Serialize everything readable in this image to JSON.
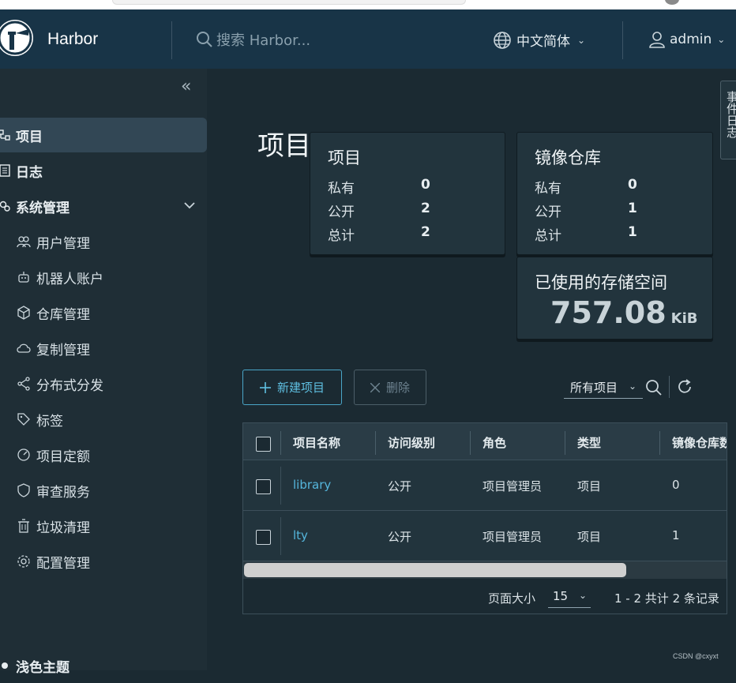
{
  "header": {
    "brand": "Harbor",
    "search_placeholder": "搜索 Harbor...",
    "language": "中文简体",
    "user": "admin"
  },
  "sidebar": {
    "items": [
      {
        "label": "项目",
        "icon": "projects-icon",
        "active": true
      },
      {
        "label": "日志",
        "icon": "logs-icon"
      },
      {
        "label": "系统管理",
        "icon": "admin-icon"
      },
      {
        "label": "用户管理",
        "icon": "users-icon"
      },
      {
        "label": "机器人账户",
        "icon": "robot-icon"
      },
      {
        "label": "仓库管理",
        "icon": "box-icon"
      },
      {
        "label": "复制管理",
        "icon": "cloud-icon"
      },
      {
        "label": "分布式分发",
        "icon": "share-icon"
      },
      {
        "label": "标签",
        "icon": "tag-icon"
      },
      {
        "label": "项目定额",
        "icon": "gauge-icon"
      },
      {
        "label": "审查服务",
        "icon": "shield-icon"
      },
      {
        "label": "垃圾清理",
        "icon": "trash-icon"
      },
      {
        "label": "配置管理",
        "icon": "gear-icon"
      },
      {
        "label": "浅色主题",
        "icon": "sun-icon"
      }
    ]
  },
  "page": {
    "title": "项目",
    "side_tab": "事件日志"
  },
  "cards": {
    "projects": {
      "title": "项目",
      "private_label": "私有",
      "private": "0",
      "public_label": "公开",
      "public": "2",
      "total_label": "总计",
      "total": "2"
    },
    "repos": {
      "title": "镜像仓库",
      "private_label": "私有",
      "private": "0",
      "public_label": "公开",
      "public": "1",
      "total_label": "总计",
      "total": "1"
    },
    "storage": {
      "title": "已使用的存储空间",
      "value": "757.08",
      "unit": "KiB"
    }
  },
  "toolbar": {
    "new_label": "新建项目",
    "delete_label": "删除",
    "filter": "所有项目"
  },
  "table": {
    "headers": [
      "项目名称",
      "访问级别",
      "角色",
      "类型",
      "镜像仓库数"
    ],
    "rows": [
      [
        "library",
        "公开",
        "项目管理员",
        "项目",
        "0"
      ],
      [
        "lty",
        "公开",
        "项目管理员",
        "项目",
        "1"
      ]
    ],
    "page_size_label": "页面大小",
    "page_size": "15",
    "count_text": "1 - 2 共计 2 条记录"
  },
  "watermark": "CSDN @cxyxt",
  "colors": {
    "header": "#183447",
    "sidebar": "#1f2e36",
    "accent": "#55b6dc"
  }
}
